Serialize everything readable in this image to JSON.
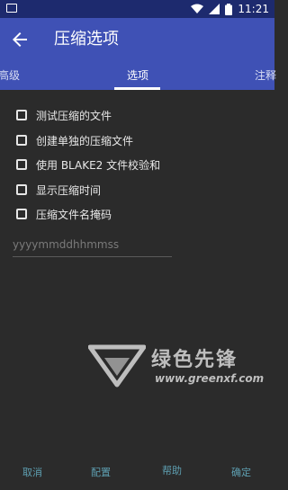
{
  "status_bar": {
    "time": "11:21"
  },
  "app_bar": {
    "title": "压缩选项"
  },
  "tabs": [
    {
      "label": "高级"
    },
    {
      "label": "选项"
    },
    {
      "label": "注释"
    }
  ],
  "options": [
    {
      "label": "测试压缩的文件",
      "checked": false
    },
    {
      "label": "创建单独的压缩文件",
      "checked": false
    },
    {
      "label": "使用 BLAKE2 文件校验和",
      "checked": false
    },
    {
      "label": "显示压缩时间",
      "checked": false
    },
    {
      "label": "压缩文件名掩码",
      "checked": false
    }
  ],
  "mask_input": {
    "placeholder": "yyyymmddhhmmss"
  },
  "watermark": {
    "main": "绿色先锋",
    "sub": "www.greenxf.com"
  },
  "buttons": {
    "cancel": "取消",
    "config": "配置",
    "help": "帮助",
    "ok": "确定"
  },
  "colors": {
    "status_bar": "#1d2a6e",
    "app_bar": "#3f51b5",
    "background": "#2b2b2b",
    "button_text": "#5e9fb1"
  }
}
